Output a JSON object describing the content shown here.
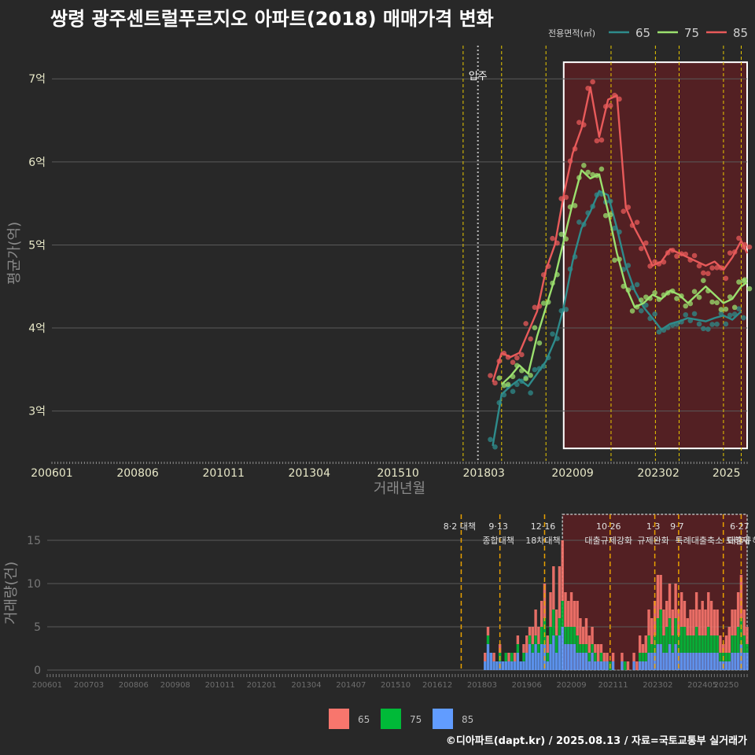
{
  "title": "쌍령 광주센트럴푸르지오 아파트(2018) 매매가격 변화",
  "credit": "©디아파트(dapt.kr) / 2025.08.13 / 자료=국토교통부 실거래가",
  "colors": {
    "background": "#282828",
    "grid": "#5a5a5a",
    "price_65": "#2e8b8b",
    "price_75": "#9be06e",
    "price_85": "#e85a5a",
    "volume_65": "#f8766d",
    "volume_75": "#00ba38",
    "volume_85": "#619cff",
    "policy_line": "#e8c800",
    "policy_line_lower": "#e8a000",
    "highlight_fill": "#5a1f22"
  },
  "chart_data": [
    {
      "type": "line",
      "ylabel": "평균가(억)",
      "xlabel": "거래년월",
      "ylim": [
        2.4,
        7.4
      ],
      "xlim": [
        "2006-01",
        "2025-08"
      ],
      "y_ticks": [
        {
          "value": 3,
          "label": "3억"
        },
        {
          "value": 4,
          "label": "4억"
        },
        {
          "value": 5,
          "label": "5억"
        },
        {
          "value": 6,
          "label": "6억"
        },
        {
          "value": 7,
          "label": "7억"
        }
      ],
      "x_ticks": [
        "200601",
        "200806",
        "201011",
        "201304",
        "201510",
        "201803",
        "202009",
        "202302",
        "2025"
      ],
      "legend": {
        "title": "전용면적(㎡)",
        "placement": "top-right",
        "entries": [
          "65",
          "75",
          "85"
        ]
      },
      "annotations": [
        {
          "label": "입주",
          "x": "2018-01"
        }
      ],
      "policy_lines": [
        "2017-08",
        "2018-09",
        "2019-12",
        "2021-10",
        "2023-01",
        "2023-09",
        "2024-12",
        "2025-06"
      ],
      "highlight": {
        "from": "2020-06",
        "to": "2025-08",
        "ymin": 2.55,
        "ymax": 7.2
      },
      "series": [
        {
          "name": "65",
          "x": [
            "2018-06",
            "2018-09",
            "2018-12",
            "2019-03",
            "2019-06",
            "2019-09",
            "2019-12",
            "2020-03",
            "2020-06",
            "2020-09",
            "2020-12",
            "2021-03",
            "2021-06",
            "2021-09",
            "2021-12",
            "2022-03",
            "2022-06",
            "2022-09",
            "2022-12",
            "2023-03",
            "2023-06",
            "2023-09",
            "2023-12",
            "2024-03",
            "2024-06",
            "2024-09",
            "2024-12",
            "2025-03",
            "2025-06"
          ],
          "values": [
            2.58,
            3.2,
            3.3,
            3.38,
            3.3,
            3.45,
            3.6,
            3.85,
            4.25,
            4.8,
            5.2,
            5.4,
            5.65,
            5.6,
            5.2,
            4.75,
            4.45,
            4.25,
            4.12,
            3.98,
            4.05,
            4.08,
            4.12,
            4.1,
            4.08,
            4.12,
            4.15,
            4.1,
            4.2
          ]
        },
        {
          "name": "75",
          "x": [
            "2018-09",
            "2018-12",
            "2019-03",
            "2019-06",
            "2019-09",
            "2019-12",
            "2020-03",
            "2020-06",
            "2020-09",
            "2020-12",
            "2021-03",
            "2021-06",
            "2021-09",
            "2021-12",
            "2022-03",
            "2022-06",
            "2022-09",
            "2022-12",
            "2023-03",
            "2023-06",
            "2023-09",
            "2023-12",
            "2024-03",
            "2024-06",
            "2024-09",
            "2024-12",
            "2025-03",
            "2025-06",
            "2025-08"
          ],
          "values": [
            3.32,
            3.42,
            3.55,
            3.45,
            3.9,
            4.25,
            4.6,
            5.05,
            5.5,
            5.9,
            5.8,
            5.85,
            5.4,
            4.9,
            4.5,
            4.25,
            4.3,
            4.4,
            4.35,
            4.45,
            4.4,
            4.3,
            4.4,
            4.5,
            4.4,
            4.3,
            4.35,
            4.5,
            4.55
          ]
        },
        {
          "name": "85",
          "x": [
            "2018-06",
            "2018-09",
            "2018-12",
            "2019-03",
            "2019-06",
            "2019-09",
            "2019-12",
            "2020-03",
            "2020-06",
            "2020-09",
            "2020-12",
            "2021-03",
            "2021-06",
            "2021-09",
            "2021-12",
            "2022-03",
            "2022-06",
            "2022-09",
            "2022-12",
            "2023-03",
            "2023-06",
            "2023-09",
            "2023-12",
            "2024-03",
            "2024-06",
            "2024-09",
            "2024-12",
            "2025-03",
            "2025-06",
            "2025-08"
          ],
          "values": [
            3.35,
            3.7,
            3.65,
            3.7,
            3.95,
            4.2,
            4.7,
            5.0,
            5.6,
            6.1,
            6.4,
            6.9,
            6.3,
            6.75,
            6.8,
            5.45,
            5.2,
            5.0,
            4.75,
            4.8,
            4.95,
            4.9,
            4.85,
            4.8,
            4.75,
            4.8,
            4.7,
            4.85,
            5.05,
            4.9
          ]
        }
      ]
    },
    {
      "type": "bar",
      "ylabel": "거래량(건)",
      "ylim": [
        0,
        18
      ],
      "y_ticks": [
        0,
        5,
        10,
        15
      ],
      "x_ticks": [
        "200601",
        "200703",
        "200806",
        "200908",
        "201011",
        "201201",
        "201304",
        "201407",
        "201510",
        "201612",
        "201803",
        "201906",
        "202009",
        "202111",
        "202302",
        "202405",
        "20250"
      ],
      "legend": {
        "placement": "bottom",
        "entries": [
          "65",
          "75",
          "85"
        ]
      },
      "policy_events": [
        {
          "x": "2017-08",
          "label1": "8·2 대책",
          "label2": ""
        },
        {
          "x": "2018-09",
          "label1": "9·13",
          "label2": "종합대책"
        },
        {
          "x": "2019-12",
          "label1": "12·16",
          "label2": "18차대책"
        },
        {
          "x": "2021-10",
          "label1": "10·26",
          "label2": "대출규제강화"
        },
        {
          "x": "2023-01",
          "label1": "1·3",
          "label2": "규제완화"
        },
        {
          "x": "2023-09",
          "label1": "9·7",
          "label2": ""
        },
        {
          "x": "2024-12",
          "label1": "",
          "label2": "특례대출축소 토허제 해제"
        },
        {
          "x": "2025-06",
          "label1": "6·27",
          "label2": "대출규"
        }
      ],
      "highlight": {
        "from": "2020-06",
        "to": "2025-08",
        "ymax": 18
      },
      "x": [
        "2018-04",
        "2018-05",
        "2018-06",
        "2018-07",
        "2018-08",
        "2018-09",
        "2018-10",
        "2018-11",
        "2018-12",
        "2019-01",
        "2019-02",
        "2019-03",
        "2019-04",
        "2019-05",
        "2019-06",
        "2019-07",
        "2019-08",
        "2019-09",
        "2019-10",
        "2019-11",
        "2019-12",
        "2020-01",
        "2020-02",
        "2020-03",
        "2020-04",
        "2020-05",
        "2020-06",
        "2020-07",
        "2020-08",
        "2020-09",
        "2020-10",
        "2020-11",
        "2020-12",
        "2021-01",
        "2021-02",
        "2021-03",
        "2021-04",
        "2021-05",
        "2021-06",
        "2021-07",
        "2021-08",
        "2021-09",
        "2021-10",
        "2021-11",
        "2021-12",
        "2022-01",
        "2022-02",
        "2022-03",
        "2022-04",
        "2022-05",
        "2022-06",
        "2022-07",
        "2022-08",
        "2022-09",
        "2022-10",
        "2022-11",
        "2022-12",
        "2023-01",
        "2023-02",
        "2023-03",
        "2023-04",
        "2023-05",
        "2023-06",
        "2023-07",
        "2023-08",
        "2023-09",
        "2023-10",
        "2023-11",
        "2023-12",
        "2024-01",
        "2024-02",
        "2024-03",
        "2024-04",
        "2024-05",
        "2024-06",
        "2024-07",
        "2024-08",
        "2024-09",
        "2024-10",
        "2024-11",
        "2024-12",
        "2025-01",
        "2025-02",
        "2025-03",
        "2025-04",
        "2025-05",
        "2025-06",
        "2025-07",
        "2025-08"
      ],
      "series": [
        {
          "name": "65",
          "values": [
            1,
            1,
            0,
            1,
            0,
            1,
            0,
            0,
            1,
            0,
            1,
            1,
            0,
            1,
            2,
            1,
            2,
            3,
            2,
            3,
            4,
            2,
            4,
            5,
            3,
            6,
            7,
            4,
            3,
            4,
            3,
            4,
            3,
            2,
            3,
            2,
            2,
            1,
            2,
            1,
            1,
            1,
            0,
            1,
            0,
            0,
            1,
            0,
            1,
            0,
            1,
            1,
            2,
            1,
            2,
            3,
            3,
            4,
            5,
            4,
            3,
            3,
            4,
            3,
            4,
            3,
            4,
            3,
            2,
            3,
            3,
            4,
            3,
            4,
            3,
            4,
            4,
            3,
            3,
            2,
            1,
            2,
            3,
            3,
            3,
            4,
            5,
            3,
            2
          ]
        },
        {
          "name": "75",
          "values": [
            0,
            1,
            0,
            0,
            0,
            1,
            0,
            1,
            0,
            1,
            0,
            1,
            0,
            1,
            0,
            1,
            1,
            1,
            1,
            2,
            3,
            1,
            2,
            3,
            2,
            2,
            3,
            2,
            2,
            2,
            2,
            2,
            1,
            1,
            1,
            1,
            1,
            1,
            0,
            1,
            0,
            0,
            1,
            0,
            0,
            0,
            0,
            1,
            0,
            0,
            0,
            0,
            1,
            1,
            1,
            2,
            1,
            2,
            3,
            4,
            2,
            3,
            3,
            2,
            3,
            2,
            3,
            3,
            2,
            2,
            2,
            3,
            2,
            2,
            2,
            3,
            2,
            2,
            2,
            1,
            1,
            1,
            1,
            2,
            2,
            3,
            3,
            2,
            1
          ]
        },
        {
          "name": "85",
          "values": [
            1,
            3,
            2,
            1,
            1,
            1,
            1,
            1,
            1,
            1,
            1,
            2,
            1,
            1,
            2,
            3,
            2,
            3,
            2,
            3,
            3,
            1,
            3,
            4,
            2,
            4,
            5,
            3,
            3,
            3,
            3,
            2,
            2,
            2,
            2,
            1,
            2,
            1,
            1,
            1,
            1,
            1,
            0,
            1,
            0,
            0,
            1,
            0,
            0,
            0,
            1,
            0,
            1,
            1,
            1,
            2,
            2,
            2,
            3,
            3,
            2,
            2,
            3,
            2,
            3,
            2,
            2,
            2,
            2,
            2,
            2,
            2,
            2,
            2,
            2,
            2,
            2,
            2,
            2,
            1,
            1,
            1,
            1,
            2,
            2,
            2,
            3,
            2,
            2
          ]
        }
      ]
    }
  ]
}
